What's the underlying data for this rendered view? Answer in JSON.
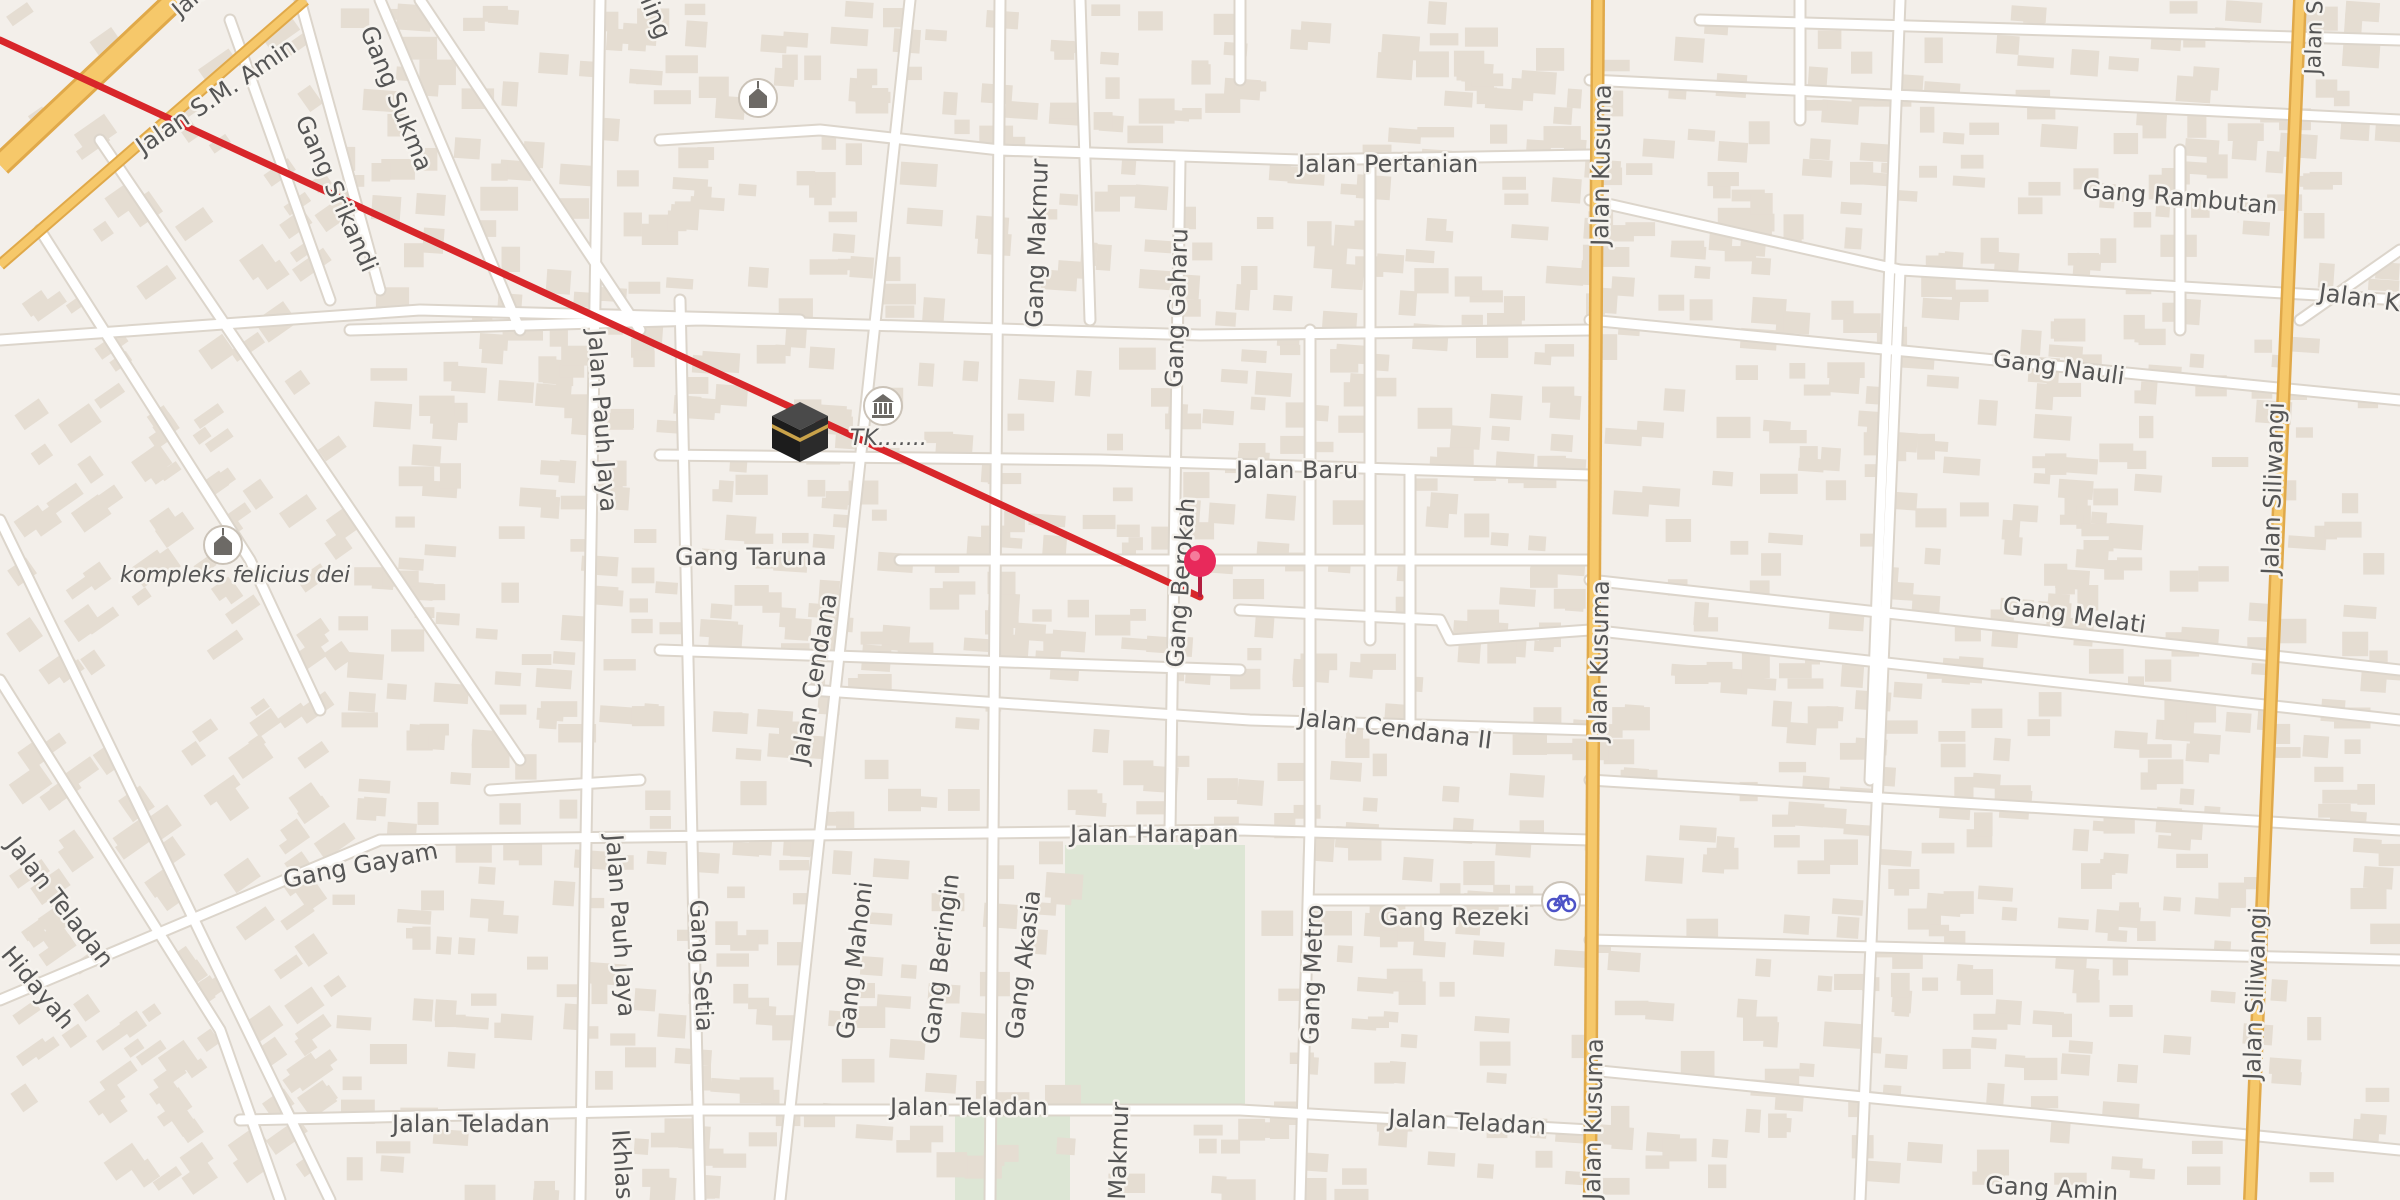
{
  "map": {
    "colors": {
      "background": "#f3efea",
      "building": "#e7e0d6",
      "road": "#ffffff",
      "road_casing": "#dcd5cb",
      "major_road": "#f6c86a",
      "major_road_casing": "#e0a94a",
      "route_line": "#d8262a",
      "park": "#dde6d5",
      "pin": "#e8295b"
    },
    "route": {
      "name": "",
      "color": "#d8262a"
    },
    "labels": {
      "jalan_sm_amin": "Jalan S.M. Amin",
      "jalan_top_corner": "Jala",
      "gang_sukma": "Gang Sukma",
      "gang_srikandi": "Gang Srikandi",
      "gang_top_ling": "ling",
      "jalan_pertanian": "Jalan Pertanian",
      "gang_makmur": "Gang Makmur",
      "gang_gaharu": "Gang Gaharu",
      "jalan_kusuma_top": "Jalan Kusuma",
      "jalan_kusuma_mid": "Jalan Kusuma",
      "jalan_kusuma_bottom": "Jalan Kusuma",
      "gang_rambutan": "Gang Rambutan",
      "jalan_ke": "Jalan Ke",
      "jalan_top_right": "Jalan S",
      "gang_nauli": "Gang Nauli",
      "jalan_siliwangi_top": "Jalan Siliwangi",
      "jalan_siliwangi_bottom": "Jalan Siliwangi",
      "jalan_pauh_jaya_top": "Jalan Pauh Jaya",
      "jalan_pauh_jaya_bottom": "Jalan Pauh Jaya",
      "tk_label": "TK.......",
      "jalan_baru": "Jalan Baru",
      "gang_taruna": "Gang Taruna",
      "gang_berokah": "Gang Berokah",
      "kompleks_felicius_dei": "kompleks felicius dei",
      "jalan_cendana": "Jalan Cendana",
      "jalan_cendana_ii": "Jalan Cendana II",
      "gang_melati": "Gang Melati",
      "jalan_harapan": "Jalan Harapan",
      "gang_gayam": "Gang Gayam",
      "gang_rezeki": "Gang Rezeki",
      "jalan_teladan_left": "Jalan Teladan",
      "jalan_teladan_1": "Jalan Teladan",
      "jalan_teladan_2": "Jalan Teladan",
      "jalan_teladan_3": "Jalan Teladan",
      "hidayah": "Hidayah",
      "gang_setia": "Gang Setia",
      "gang_mahoni": "Gang Mahoni",
      "gang_beringin": "Gang Beringin",
      "gang_akasia": "Gang Akasia",
      "gang_metro": "Gang Metro",
      "makmur_bottom": "Makmur",
      "ikhlas_bottom": "Ikhlas",
      "gang_amin": "Gang Amin"
    },
    "pois": {
      "kaaba": "kaaba-icon",
      "museum": "museum-icon",
      "church_top": "place-of-worship-icon",
      "church_kompleks": "place-of-worship-icon",
      "bicycle": "bicycle-icon",
      "pin": "location-pin-icon"
    }
  }
}
